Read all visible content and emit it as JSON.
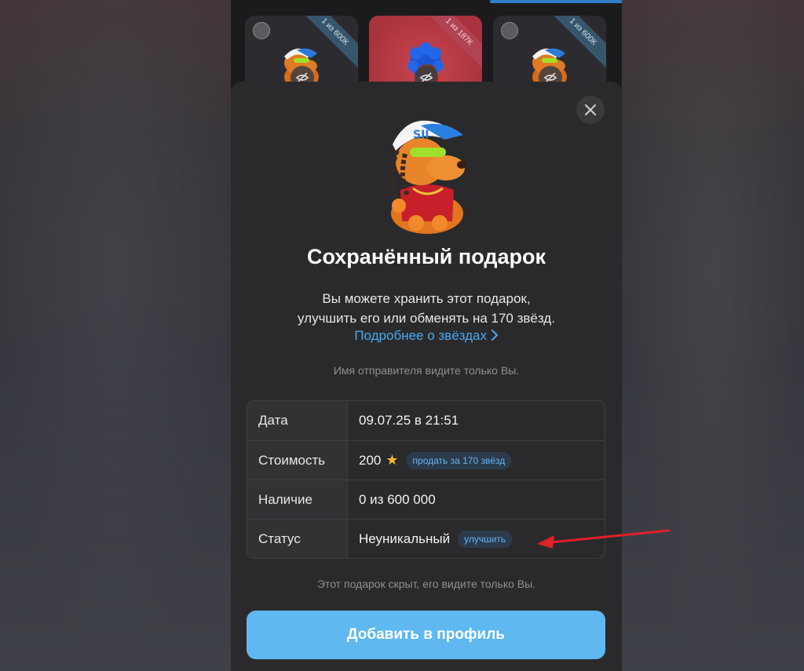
{
  "gift_strip": {
    "tiles": [
      {
        "badge": "1 из 600К"
      },
      {
        "badge": "1 из 187К"
      },
      {
        "badge": "1 из 600К"
      }
    ]
  },
  "sheet": {
    "title": "Сохранённый подарок",
    "description_line1": "Вы можете хранить этот подарок,",
    "description_line2": "улучшить его или обменять на 170 звёзд.",
    "link": "Подробнее о звёздах",
    "sender_note": "Имя отправителя видите только Вы.",
    "table": {
      "date_label": "Дата",
      "date_value": "09.07.25 в 21:51",
      "price_label": "Стоимость",
      "price_value": "200",
      "price_action": "продать за 170 звёзд",
      "availability_label": "Наличие",
      "availability_value": "0 из 600 000",
      "status_label": "Статус",
      "status_value": "Неуникальный",
      "status_action": "улучшить"
    },
    "hidden_note": "Этот подарок скрыт, его видите только Вы.",
    "add_button": "Добавить в профиль"
  },
  "colors": {
    "accent": "#5fb8ef",
    "link": "#4aa8f0",
    "sheet_bg": "#2a2a2c",
    "arrow": "#e0202a"
  }
}
